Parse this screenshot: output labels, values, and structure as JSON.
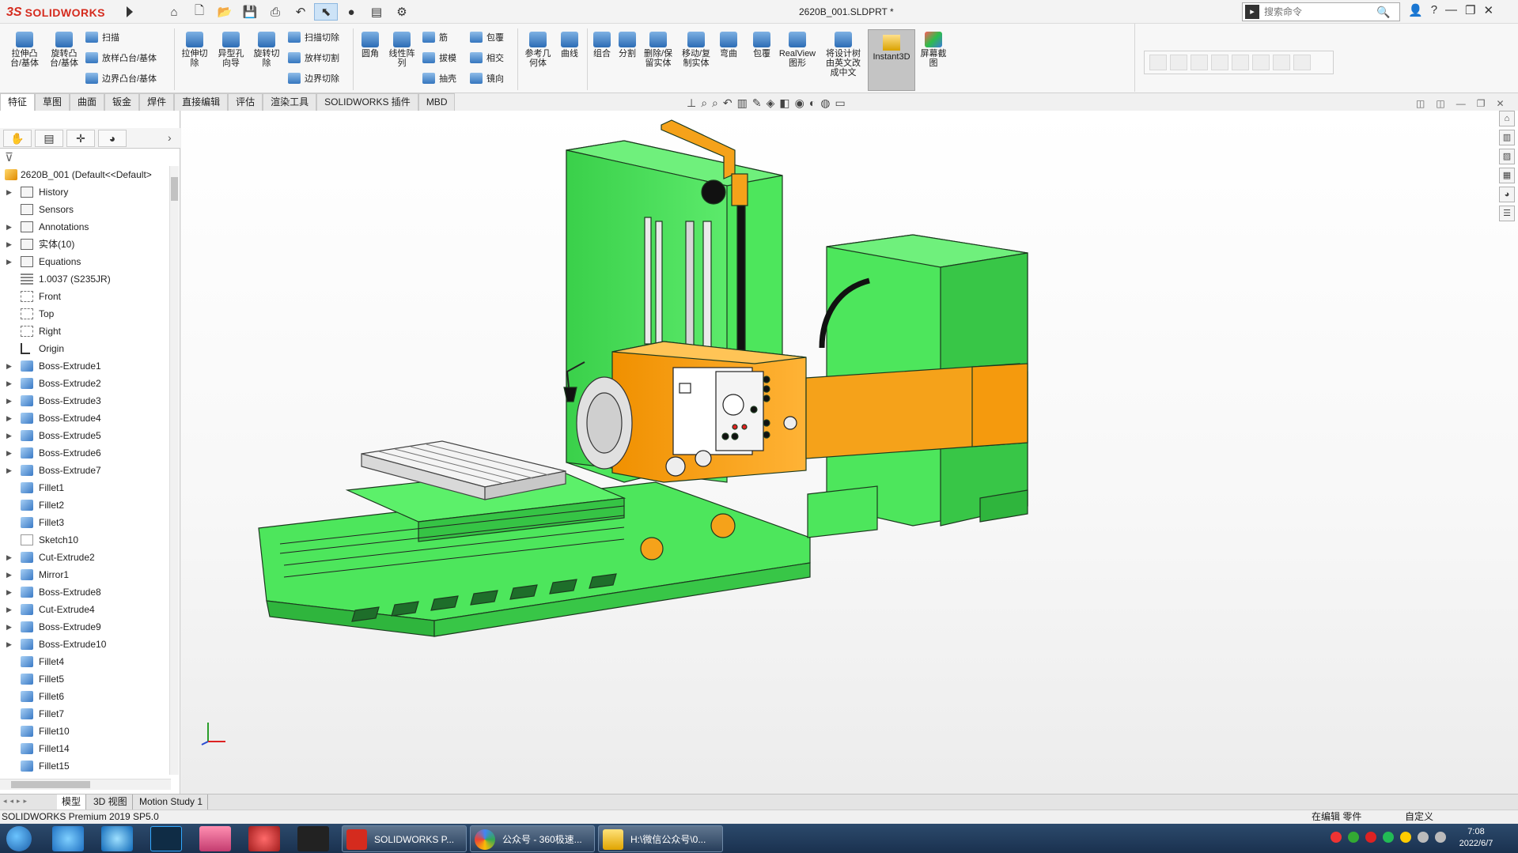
{
  "app": {
    "brand_ds": "3S",
    "brand_name": "SOLIDWORKS",
    "document_title": "2620B_001.SLDPRT *",
    "search_placeholder": "搜索命令",
    "window_buttons": [
      "?",
      "—",
      "❐",
      "✕"
    ]
  },
  "ribbon": {
    "buttons": [
      {
        "label": "拉伸凸\n台/基体"
      },
      {
        "label": "旋转凸\n台/基体"
      },
      {
        "label": "扫描"
      },
      {
        "label": "放样凸台/基体"
      },
      {
        "label": "边界凸台/基体"
      },
      {
        "label": "拉伸切\n除"
      },
      {
        "label": "异型孔\n向导"
      },
      {
        "label": "旋转切\n除"
      },
      {
        "label": "扫描切除"
      },
      {
        "label": "放样切割"
      },
      {
        "label": "边界切除"
      },
      {
        "label": "圆角"
      },
      {
        "label": "线性阵\n列"
      },
      {
        "label": "筋"
      },
      {
        "label": "拔模"
      },
      {
        "label": "抽壳"
      },
      {
        "label": "包覆"
      },
      {
        "label": "相交"
      },
      {
        "label": "镜向"
      },
      {
        "label": "参考几\n何体"
      },
      {
        "label": "曲线"
      },
      {
        "label": "组合"
      },
      {
        "label": "分割"
      },
      {
        "label": "删除/保\n留实体"
      },
      {
        "label": "移动/复\n制实体"
      },
      {
        "label": "弯曲"
      },
      {
        "label": "包覆"
      },
      {
        "label": "RealView\n图形"
      },
      {
        "label": "将设计树\n由英文改\n成中文"
      },
      {
        "label": "Instant3D"
      },
      {
        "label": "屏幕截\n图"
      }
    ]
  },
  "command_tabs": [
    "特征",
    "草图",
    "曲面",
    "钣金",
    "焊件",
    "直接编辑",
    "评估",
    "渲染工具",
    "SOLIDWORKS 插件",
    "MBD"
  ],
  "active_command_tab": "特征",
  "feature_tree": {
    "root": "2620B_001  (Default<<Default>",
    "items": [
      {
        "label": "History",
        "icon": "history-icon"
      },
      {
        "label": "Sensors",
        "icon": "sensor-icon"
      },
      {
        "label": "Annotations",
        "icon": "annotation-icon"
      },
      {
        "label": "实体(10)",
        "icon": "solid-bodies-icon"
      },
      {
        "label": "Equations",
        "icon": "equation-icon"
      },
      {
        "label": "1.0037 (S235JR)",
        "icon": "material-icon"
      },
      {
        "label": "Front",
        "icon": "plane-icon"
      },
      {
        "label": "Top",
        "icon": "plane-icon"
      },
      {
        "label": "Right",
        "icon": "plane-icon"
      },
      {
        "label": "Origin",
        "icon": "origin-icon"
      },
      {
        "label": "Boss-Extrude1",
        "icon": "extrude-icon"
      },
      {
        "label": "Boss-Extrude2",
        "icon": "extrude-icon"
      },
      {
        "label": "Boss-Extrude3",
        "icon": "extrude-icon"
      },
      {
        "label": "Boss-Extrude4",
        "icon": "extrude-icon"
      },
      {
        "label": "Boss-Extrude5",
        "icon": "extrude-icon"
      },
      {
        "label": "Boss-Extrude6",
        "icon": "extrude-icon"
      },
      {
        "label": "Boss-Extrude7",
        "icon": "extrude-icon"
      },
      {
        "label": "Fillet1",
        "icon": "fillet-icon"
      },
      {
        "label": "Fillet2",
        "icon": "fillet-icon"
      },
      {
        "label": "Fillet3",
        "icon": "fillet-icon"
      },
      {
        "label": "Sketch10",
        "icon": "sketch-icon"
      },
      {
        "label": "Cut-Extrude2",
        "icon": "cut-icon"
      },
      {
        "label": "Mirror1",
        "icon": "mirror-icon"
      },
      {
        "label": "Boss-Extrude8",
        "icon": "extrude-icon"
      },
      {
        "label": "Cut-Extrude4",
        "icon": "cut-icon"
      },
      {
        "label": "Boss-Extrude9",
        "icon": "extrude-icon"
      },
      {
        "label": "Boss-Extrude10",
        "icon": "extrude-icon"
      },
      {
        "label": "Fillet4",
        "icon": "fillet-icon"
      },
      {
        "label": "Fillet5",
        "icon": "fillet-icon"
      },
      {
        "label": "Fillet6",
        "icon": "fillet-icon"
      },
      {
        "label": "Fillet7",
        "icon": "fillet-icon"
      },
      {
        "label": "Fillet10",
        "icon": "fillet-icon"
      },
      {
        "label": "Fillet14",
        "icon": "fillet-icon"
      },
      {
        "label": "Fillet15",
        "icon": "fillet-icon"
      }
    ]
  },
  "bottom_tabs": [
    "模型",
    "3D 视图",
    "Motion Study 1"
  ],
  "status": {
    "product": "SOLIDWORKS Premium 2019 SP5.0",
    "mode": "在编辑 零件",
    "units": "自定义"
  },
  "taskbar": {
    "windows": [
      "SOLIDWORKS P...",
      "公众号 - 360极速...",
      "H:\\微信公众号\\0..."
    ],
    "time": "7:08",
    "date": "2022/6/7"
  },
  "colors": {
    "machine_green": "#4de65c",
    "machine_orange": "#f5a21a",
    "brand_red": "#d52b1e"
  }
}
